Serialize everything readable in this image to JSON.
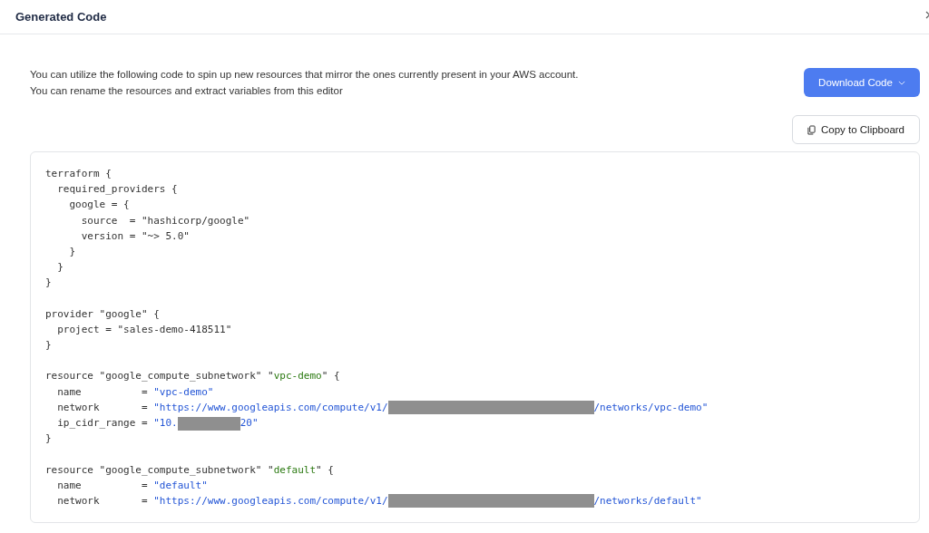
{
  "header": {
    "title": "Generated Code"
  },
  "intro": [
    "You can utilize the following code to spin up new resources that mirror the ones currently present in your AWS account.",
    "You can rename the resources and extract variables from this editor"
  ],
  "download_button": {
    "label": "Download Code"
  },
  "copy_button": {
    "label": "Copy to Clipboard"
  },
  "code_blocks": [
    [
      [
        {
          "kind": "plain",
          "text": "terraform {"
        }
      ],
      [
        {
          "kind": "plain",
          "text": "  required_providers {"
        }
      ],
      [
        {
          "kind": "plain",
          "text": "    google = {"
        }
      ],
      [
        {
          "kind": "plain",
          "text": "      source  = \"hashicorp/google\""
        }
      ],
      [
        {
          "kind": "plain",
          "text": "      version = \"~> 5.0\""
        }
      ],
      [
        {
          "kind": "plain",
          "text": "    }"
        }
      ],
      [
        {
          "kind": "plain",
          "text": "  }"
        }
      ],
      [
        {
          "kind": "plain",
          "text": "}"
        }
      ]
    ],
    [
      [
        {
          "kind": "plain",
          "text": "provider \"google\" {"
        }
      ],
      [
        {
          "kind": "plain",
          "text": "  project = \"sales-demo-418511\""
        }
      ],
      [
        {
          "kind": "plain",
          "text": "}"
        }
      ]
    ],
    [
      [
        {
          "kind": "plain",
          "text": "resource \"google_compute_subnetwork\" \""
        },
        {
          "kind": "name",
          "text": "vpc-demo"
        },
        {
          "kind": "plain",
          "text": "\" {"
        }
      ],
      [
        {
          "kind": "plain",
          "text": "  name          = "
        },
        {
          "kind": "string",
          "text": "\"vpc-demo\""
        }
      ],
      [
        {
          "kind": "plain",
          "text": "  network       = "
        },
        {
          "kind": "string",
          "text": "\"https://www.googleapis.com/compute/v1/"
        },
        {
          "kind": "redaction_long"
        },
        {
          "kind": "string",
          "text": "/networks/vpc-demo\""
        }
      ],
      [
        {
          "kind": "plain",
          "text": "  ip_cidr_range = "
        },
        {
          "kind": "string",
          "text": "\"10."
        },
        {
          "kind": "redaction_short"
        },
        {
          "kind": "string",
          "text": "20\""
        }
      ],
      [
        {
          "kind": "plain",
          "text": "}"
        }
      ]
    ],
    [
      [
        {
          "kind": "plain",
          "text": "resource \"google_compute_subnetwork\" \""
        },
        {
          "kind": "name",
          "text": "default"
        },
        {
          "kind": "plain",
          "text": "\" {"
        }
      ],
      [
        {
          "kind": "plain",
          "text": "  name          = "
        },
        {
          "kind": "string",
          "text": "\"default\""
        }
      ],
      [
        {
          "kind": "plain",
          "text": "  network       = "
        },
        {
          "kind": "string",
          "text": "\"https://www.googleapis.com/compute/v1/"
        },
        {
          "kind": "redaction_long"
        },
        {
          "kind": "string",
          "text": "/networks/default\""
        }
      ]
    ]
  ]
}
